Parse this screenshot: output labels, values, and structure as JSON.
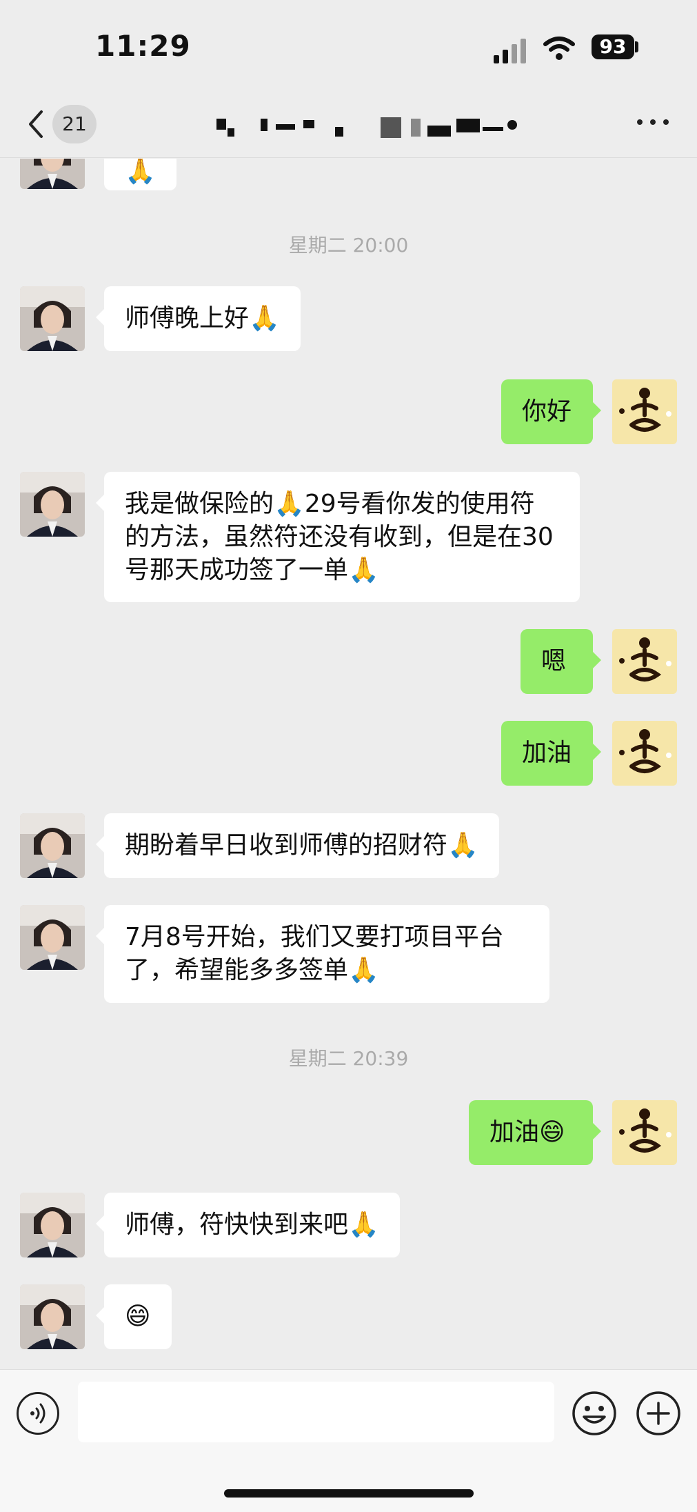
{
  "status_bar": {
    "time": "11:29",
    "battery": "93"
  },
  "header": {
    "unread_count": "21"
  },
  "timestamps": [
    "星期二 20:00",
    "星期二 20:39"
  ],
  "messages": [
    {
      "from": "other",
      "text": "师傅晚上好🙏"
    },
    {
      "from": "me",
      "text": "你好"
    },
    {
      "from": "other",
      "text": "我是做保险的🙏29号看你发的使用符的方法，虽然符还没有收到，但是在30号那天成功签了一单🙏"
    },
    {
      "from": "me",
      "text": "嗯"
    },
    {
      "from": "me",
      "text": "加油"
    },
    {
      "from": "other",
      "text": "期盼着早日收到师傅的招财符🙏"
    },
    {
      "from": "other",
      "text": "7月8号开始，我们又要打项目平台了，希望能多多签单🙏"
    },
    {
      "from": "me",
      "text": "加油😄"
    },
    {
      "from": "other",
      "text": "师傅，符快快到来吧🙏"
    },
    {
      "from": "other",
      "text": "😄"
    }
  ],
  "partial_top_message": {
    "from": "other",
    "text": "🙏"
  },
  "icons": {
    "back": "chevron-left-icon",
    "more": "more-dots-icon",
    "voice": "voice-icon",
    "emoji": "emoji-icon",
    "plus": "plus-icon"
  },
  "colors": {
    "background": "#ededed",
    "my_bubble": "#95ec69",
    "their_bubble": "#ffffff"
  }
}
